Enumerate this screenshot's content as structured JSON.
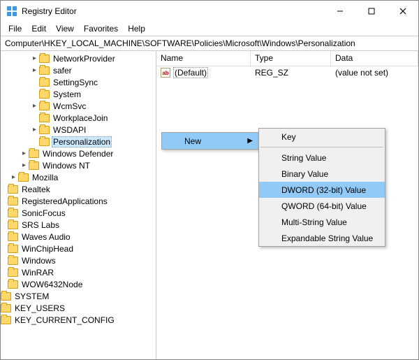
{
  "window": {
    "title": "Registry Editor"
  },
  "menubar": [
    "File",
    "Edit",
    "View",
    "Favorites",
    "Help"
  ],
  "address": "Computer\\HKEY_LOCAL_MACHINE\\SOFTWARE\\Policies\\Microsoft\\Windows\\Personalization",
  "columns": {
    "name": "Name",
    "type": "Type",
    "data": "Data"
  },
  "values": [
    {
      "name": "(Default)",
      "type": "REG_SZ",
      "data": "(value not set)"
    }
  ],
  "ctx_new": {
    "label": "New"
  },
  "ctx_sub": {
    "key": "Key",
    "string": "String Value",
    "binary": "Binary Value",
    "dword": "DWORD (32-bit) Value",
    "qword": "QWORD (64-bit) Value",
    "multi": "Multi-String Value",
    "expand": "Expandable String Value"
  },
  "tree": {
    "n0": "NetworkProvider",
    "n1": "safer",
    "n2": "SettingSync",
    "n3": "System",
    "n4": "WcmSvc",
    "n5": "WorkplaceJoin",
    "n6": "WSDAPI",
    "n7": "Personalization",
    "n8": "Windows Defender",
    "n9": "Windows NT",
    "n10": "Mozilla",
    "n11": "Realtek",
    "n12": "RegisteredApplications",
    "n13": "SonicFocus",
    "n14": "SRS Labs",
    "n15": "Waves Audio",
    "n16": "WinChipHead",
    "n17": "Windows",
    "n18": "WinRAR",
    "n19": "WOW6432Node",
    "n20": "SYSTEM",
    "n21": "KEY_USERS",
    "n22": "KEY_CURRENT_CONFIG"
  }
}
